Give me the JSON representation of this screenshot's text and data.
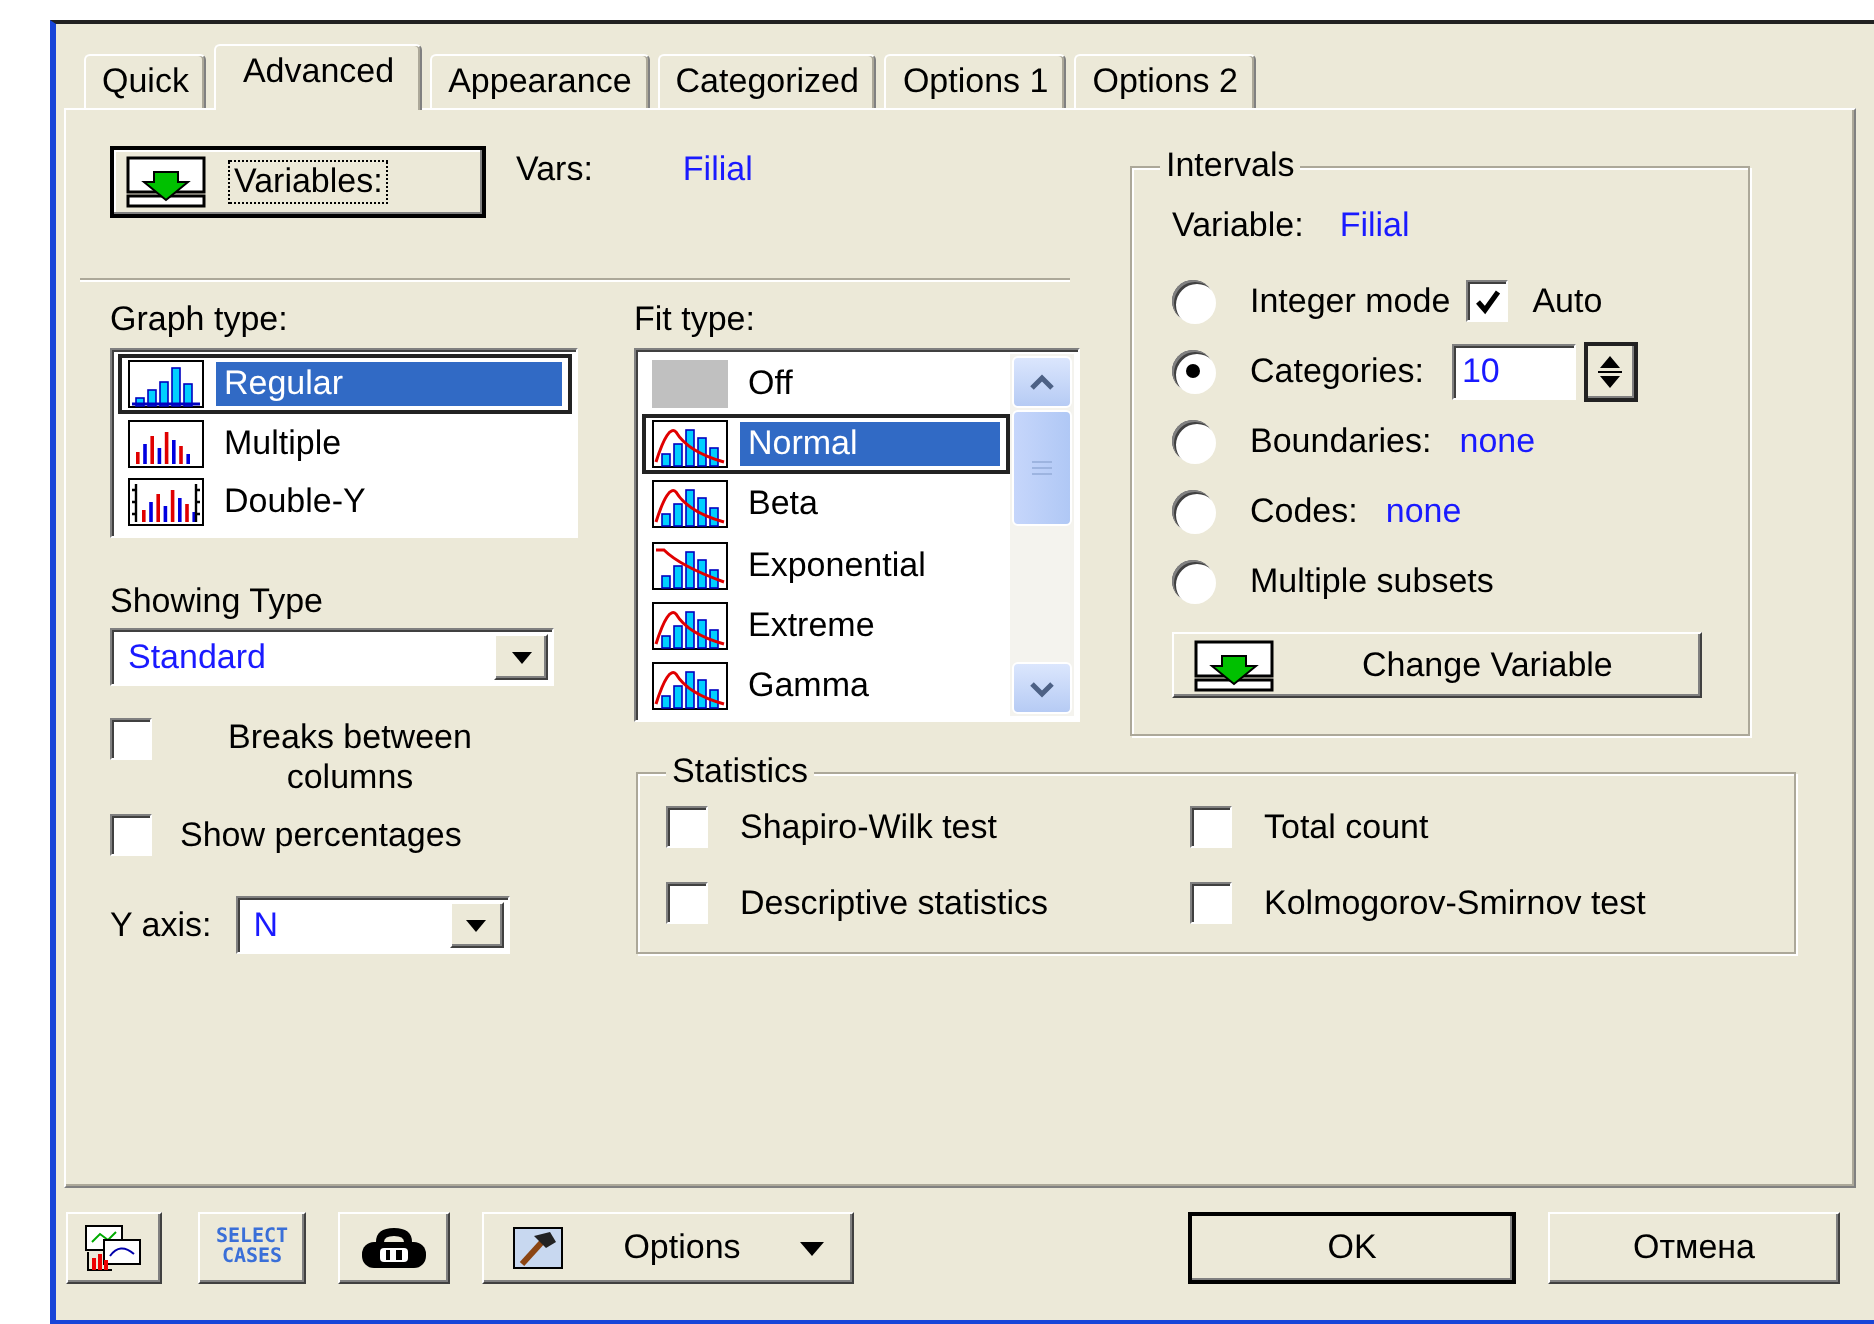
{
  "tabs": [
    {
      "label": "Quick",
      "selected": false
    },
    {
      "label": "Advanced",
      "selected": true
    },
    {
      "label": "Appearance",
      "selected": false
    },
    {
      "label": "Categorized",
      "selected": false
    },
    {
      "label": "Options 1",
      "selected": false
    },
    {
      "label": "Options 2",
      "selected": false
    }
  ],
  "variables": {
    "button": "Variables:",
    "label": "Vars:",
    "value": "Filial"
  },
  "graph_type": {
    "label": "Graph type:",
    "items": [
      {
        "label": "Regular",
        "selected": true
      },
      {
        "label": "Multiple",
        "selected": false
      },
      {
        "label": "Double-Y",
        "selected": false
      }
    ]
  },
  "fit_type": {
    "label": "Fit type:",
    "items": [
      {
        "label": "Off",
        "selected": false,
        "kind": "off"
      },
      {
        "label": "Normal",
        "selected": true,
        "kind": "curve"
      },
      {
        "label": "Beta",
        "selected": false,
        "kind": "curve"
      },
      {
        "label": "Exponential",
        "selected": false,
        "kind": "decay"
      },
      {
        "label": "Extreme",
        "selected": false,
        "kind": "curve"
      },
      {
        "label": "Gamma",
        "selected": false,
        "kind": "curve"
      }
    ]
  },
  "showing_type": {
    "label": "Showing Type",
    "value": "Standard"
  },
  "options": [
    {
      "label": "Breaks between columns",
      "checked": false
    },
    {
      "label": "Show percentages",
      "checked": false
    }
  ],
  "y_axis": {
    "label": "Y axis:",
    "value": "N"
  },
  "intervals": {
    "title": "Intervals",
    "variable_label": "Variable:",
    "variable_value": "Filial",
    "options": [
      {
        "label": "Integer mode",
        "selected": false,
        "kind": "checkbox",
        "extra": {
          "label": "Auto",
          "checked": true
        }
      },
      {
        "label": "Categories:",
        "selected": true,
        "kind": "spin",
        "value": "10"
      },
      {
        "label": "Boundaries:",
        "selected": false,
        "kind": "value",
        "value": "none"
      },
      {
        "label": "Codes:",
        "selected": false,
        "kind": "value",
        "value": "none"
      },
      {
        "label": "Multiple subsets",
        "selected": false,
        "kind": "plain"
      }
    ],
    "button": "Change Variable"
  },
  "statistics": {
    "title": "Statistics",
    "items": [
      {
        "label": "Shapiro-Wilk test",
        "checked": false
      },
      {
        "label": "Total count",
        "checked": false
      },
      {
        "label": "Descriptive statistics",
        "checked": false
      },
      {
        "label": "Kolmogorov-Smirnov test",
        "checked": false
      }
    ]
  },
  "footer": {
    "select_cases": "SELECT CASES",
    "options": "Options",
    "ok": "OK",
    "cancel": "Отмена"
  }
}
